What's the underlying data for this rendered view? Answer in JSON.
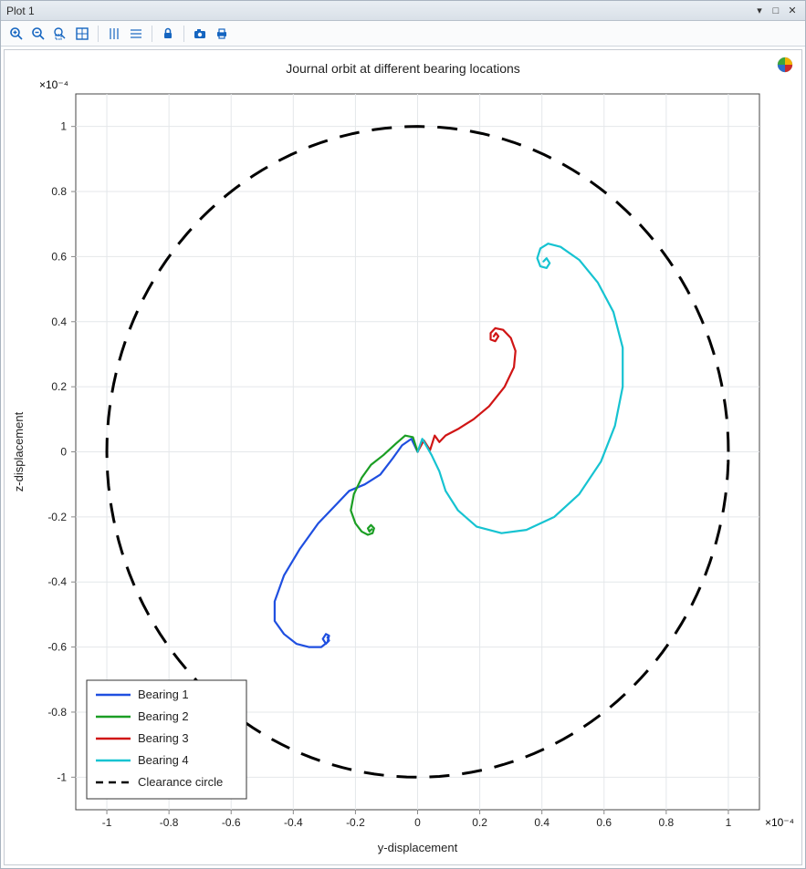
{
  "window": {
    "title": "Plot 1",
    "buttons": {
      "min": "▾",
      "max": "□",
      "close": "✕"
    }
  },
  "toolbar": {
    "zoom_in": "zoom-in",
    "zoom_out": "zoom-out",
    "zoom_box": "zoom-box",
    "zoom_extents": "zoom-extents",
    "grid_x": "grid-x",
    "grid_y": "grid-y",
    "lock": "lock",
    "camera": "camera",
    "print": "print"
  },
  "brand_icon": "comsol-logo",
  "chart_data": {
    "type": "line",
    "title": "Journal orbit at different bearing locations",
    "xlabel": "y-displacement",
    "ylabel": "z-displacement",
    "xlim": [
      -1.1,
      1.1
    ],
    "ylim": [
      -1.1,
      1.1
    ],
    "axis_scale_label": "×10⁻⁴",
    "x_ticks": [
      -1,
      -0.8,
      -0.6,
      -0.4,
      -0.2,
      0,
      0.2,
      0.4,
      0.6,
      0.8,
      1
    ],
    "y_ticks": [
      -1,
      -0.8,
      -0.6,
      -0.4,
      -0.2,
      0,
      0.2,
      0.4,
      0.6,
      0.8,
      1
    ],
    "grid": true,
    "legend_position": "lower-left",
    "series": [
      {
        "name": "Bearing 1",
        "color": "#1f4fe0",
        "style": "solid",
        "data": [
          [
            0,
            0
          ],
          [
            -0.02,
            0.04
          ],
          [
            -0.05,
            0.02
          ],
          [
            -0.08,
            -0.02
          ],
          [
            -0.12,
            -0.07
          ],
          [
            -0.17,
            -0.1
          ],
          [
            -0.22,
            -0.12
          ],
          [
            -0.26,
            -0.16
          ],
          [
            -0.32,
            -0.22
          ],
          [
            -0.38,
            -0.3
          ],
          [
            -0.43,
            -0.38
          ],
          [
            -0.46,
            -0.46
          ],
          [
            -0.46,
            -0.52
          ],
          [
            -0.43,
            -0.56
          ],
          [
            -0.39,
            -0.59
          ],
          [
            -0.35,
            -0.6
          ],
          [
            -0.31,
            -0.6
          ],
          [
            -0.29,
            -0.585
          ],
          [
            -0.285,
            -0.565
          ],
          [
            -0.295,
            -0.56
          ],
          [
            -0.305,
            -0.575
          ],
          [
            -0.295,
            -0.59
          ],
          [
            -0.285,
            -0.58
          ],
          [
            -0.29,
            -0.57
          ]
        ]
      },
      {
        "name": "Bearing 2",
        "color": "#1b9e24",
        "style": "solid",
        "data": [
          [
            0,
            0
          ],
          [
            -0.015,
            0.045
          ],
          [
            -0.04,
            0.05
          ],
          [
            -0.07,
            0.025
          ],
          [
            -0.11,
            -0.01
          ],
          [
            -0.15,
            -0.04
          ],
          [
            -0.18,
            -0.08
          ],
          [
            -0.205,
            -0.13
          ],
          [
            -0.215,
            -0.18
          ],
          [
            -0.2,
            -0.22
          ],
          [
            -0.18,
            -0.245
          ],
          [
            -0.16,
            -0.255
          ],
          [
            -0.145,
            -0.25
          ],
          [
            -0.14,
            -0.235
          ],
          [
            -0.15,
            -0.225
          ],
          [
            -0.16,
            -0.235
          ],
          [
            -0.155,
            -0.245
          ],
          [
            -0.148,
            -0.238
          ]
        ]
      },
      {
        "name": "Bearing 3",
        "color": "#d01515",
        "style": "solid",
        "data": [
          [
            0,
            0
          ],
          [
            0.02,
            0.035
          ],
          [
            0.04,
            0.005
          ],
          [
            0.055,
            0.05
          ],
          [
            0.07,
            0.03
          ],
          [
            0.09,
            0.05
          ],
          [
            0.13,
            0.07
          ],
          [
            0.18,
            0.1
          ],
          [
            0.23,
            0.14
          ],
          [
            0.28,
            0.2
          ],
          [
            0.31,
            0.26
          ],
          [
            0.315,
            0.31
          ],
          [
            0.3,
            0.35
          ],
          [
            0.275,
            0.375
          ],
          [
            0.25,
            0.38
          ],
          [
            0.235,
            0.365
          ],
          [
            0.235,
            0.345
          ],
          [
            0.25,
            0.34
          ],
          [
            0.26,
            0.355
          ],
          [
            0.252,
            0.365
          ],
          [
            0.245,
            0.355
          ]
        ]
      },
      {
        "name": "Bearing 4",
        "color": "#16c3d1",
        "style": "solid",
        "data": [
          [
            0,
            0
          ],
          [
            0.015,
            0.04
          ],
          [
            0.045,
            -0.01
          ],
          [
            0.07,
            -0.06
          ],
          [
            0.09,
            -0.12
          ],
          [
            0.13,
            -0.18
          ],
          [
            0.19,
            -0.23
          ],
          [
            0.27,
            -0.25
          ],
          [
            0.35,
            -0.24
          ],
          [
            0.44,
            -0.2
          ],
          [
            0.52,
            -0.13
          ],
          [
            0.59,
            -0.03
          ],
          [
            0.635,
            0.08
          ],
          [
            0.66,
            0.2
          ],
          [
            0.66,
            0.32
          ],
          [
            0.63,
            0.43
          ],
          [
            0.58,
            0.52
          ],
          [
            0.52,
            0.59
          ],
          [
            0.46,
            0.63
          ],
          [
            0.42,
            0.64
          ],
          [
            0.395,
            0.625
          ],
          [
            0.385,
            0.595
          ],
          [
            0.395,
            0.57
          ],
          [
            0.415,
            0.565
          ],
          [
            0.425,
            0.58
          ],
          [
            0.415,
            0.595
          ],
          [
            0.405,
            0.585
          ]
        ]
      },
      {
        "name": "Clearance circle",
        "color": "#000000",
        "style": "dashed",
        "shape": "circle",
        "center": [
          0,
          0
        ],
        "radius": 1.0
      }
    ]
  }
}
